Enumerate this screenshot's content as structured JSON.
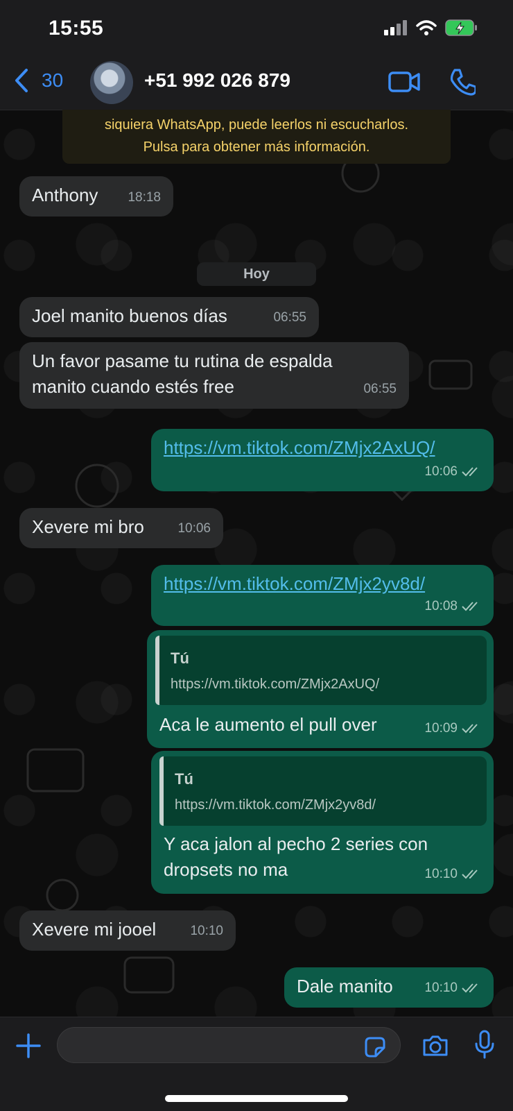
{
  "status_bar": {
    "time": "15:55"
  },
  "header": {
    "back_count": "30",
    "contact": "+51 992 026 879"
  },
  "notice": {
    "line1": "siquiera WhatsApp, puede leerlos ni escucharlos.",
    "line2": "Pulsa para obtener más información."
  },
  "date_separator": "Hoy",
  "messages": [
    {
      "dir": "in",
      "text": "Anthony",
      "time": "18:18"
    },
    {
      "dir": "in",
      "text": "Joel manito buenos días",
      "time": "06:55"
    },
    {
      "dir": "in",
      "text_lines": [
        "Un favor pasame tu rutina de espalda",
        "manito cuando estés free"
      ],
      "time": "06:55"
    },
    {
      "dir": "out",
      "link": "https://vm.tiktok.com/ZMjx2AxUQ/",
      "time": "10:06"
    },
    {
      "dir": "in",
      "text": "Xevere mi bro",
      "time": "10:06"
    },
    {
      "dir": "out",
      "link": "https://vm.tiktok.com/ZMjx2yv8d/",
      "time": "10:08"
    },
    {
      "dir": "out",
      "quote_author": "Tú",
      "quote_text": "https://vm.tiktok.com/ZMjx2AxUQ/",
      "text": "Aca le aumento el pull over",
      "time": "10:09"
    },
    {
      "dir": "out",
      "quote_author": "Tú",
      "quote_text": "https://vm.tiktok.com/ZMjx2yv8d/",
      "text_lines": [
        "Y aca jalon al pecho 2 series con",
        "dropsets no ma"
      ],
      "time": "10:10"
    },
    {
      "dir": "in",
      "text": "Xevere mi jooel",
      "time": "10:10"
    },
    {
      "dir": "out",
      "text": "Dale manito",
      "time": "10:10"
    }
  ],
  "colors": {
    "accent": "#3d8df5",
    "outgoing": "#0c5b48",
    "incoming": "#2a2b2c",
    "link": "#53bdeb",
    "notice_text": "#f6d36a"
  },
  "icons": [
    "back-chevron-icon",
    "video-call-icon",
    "phone-icon",
    "plus-icon",
    "sticker-icon",
    "camera-icon",
    "microphone-icon",
    "double-check-icon",
    "wifi-icon",
    "signal-icon",
    "battery-icon"
  ]
}
